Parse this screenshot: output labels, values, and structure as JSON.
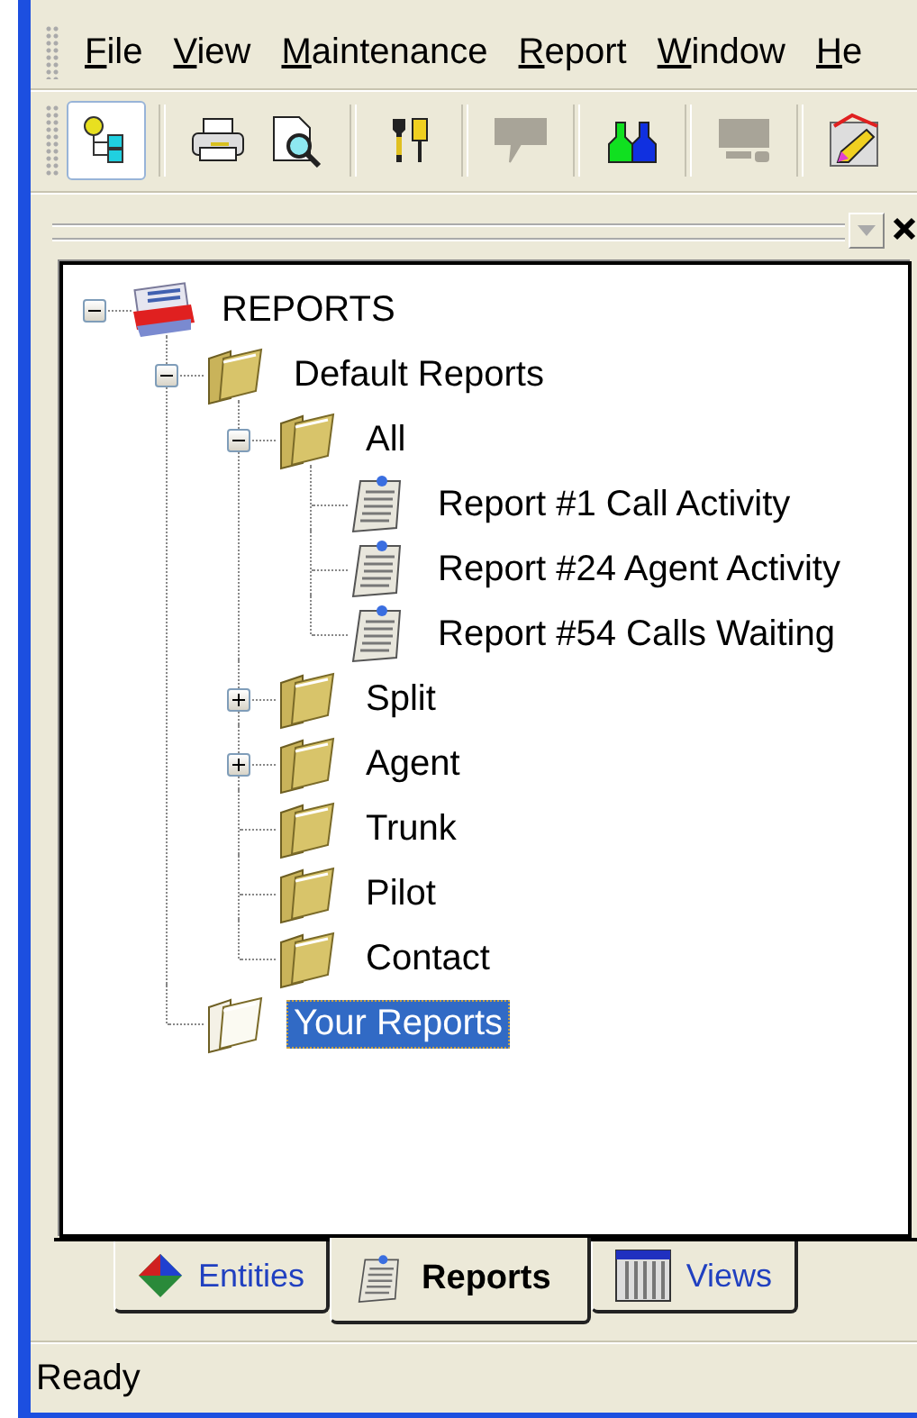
{
  "menu": [
    {
      "label": "File"
    },
    {
      "label": "View"
    },
    {
      "label": "Maintenance"
    },
    {
      "label": "Report"
    },
    {
      "label": "Window"
    },
    {
      "label": "He"
    }
  ],
  "toolbar": [
    {
      "kind": "tree",
      "pressed": true,
      "disabled": false
    },
    {
      "kind": "separator"
    },
    {
      "kind": "print",
      "pressed": false,
      "disabled": false
    },
    {
      "kind": "preview",
      "pressed": false,
      "disabled": false
    },
    {
      "kind": "separator"
    },
    {
      "kind": "tools",
      "pressed": false,
      "disabled": false
    },
    {
      "kind": "separator"
    },
    {
      "kind": "comment",
      "pressed": false,
      "disabled": true
    },
    {
      "kind": "separator"
    },
    {
      "kind": "users",
      "pressed": false,
      "disabled": false
    },
    {
      "kind": "separator"
    },
    {
      "kind": "monitor",
      "pressed": false,
      "disabled": true
    },
    {
      "kind": "separator"
    },
    {
      "kind": "pencil",
      "pressed": false,
      "disabled": false
    }
  ],
  "tree": [
    {
      "label": "REPORTS",
      "kind": "root",
      "expanded": true,
      "selected": false,
      "children": [
        {
          "label": "Default Reports",
          "kind": "folder",
          "expanded": true,
          "selected": false,
          "children": [
            {
              "label": "All",
              "kind": "folder",
              "expanded": true,
              "selected": false,
              "children": [
                {
                  "label": "Report #1 Call Activity",
                  "kind": "report",
                  "selected": false
                },
                {
                  "label": "Report #24 Agent Activity",
                  "kind": "report",
                  "selected": false
                },
                {
                  "label": "Report #54 Calls Waiting",
                  "kind": "report",
                  "selected": false
                }
              ]
            },
            {
              "label": "Split",
              "kind": "folder",
              "expanded": false,
              "selected": false
            },
            {
              "label": "Agent",
              "kind": "folder",
              "expanded": false,
              "selected": false
            },
            {
              "label": "Trunk",
              "kind": "folder",
              "selected": false
            },
            {
              "label": "Pilot",
              "kind": "folder",
              "selected": false
            },
            {
              "label": "Contact",
              "kind": "folder",
              "selected": false
            }
          ]
        },
        {
          "label": "Your Reports",
          "kind": "folder",
          "selected": true
        }
      ]
    }
  ],
  "tabs": [
    {
      "label": "Entities",
      "kind": "entities",
      "selected": false
    },
    {
      "label": "Reports",
      "kind": "reports",
      "selected": true
    },
    {
      "label": "Views",
      "kind": "views",
      "selected": false
    }
  ],
  "status_bar": {
    "text": "Ready"
  }
}
